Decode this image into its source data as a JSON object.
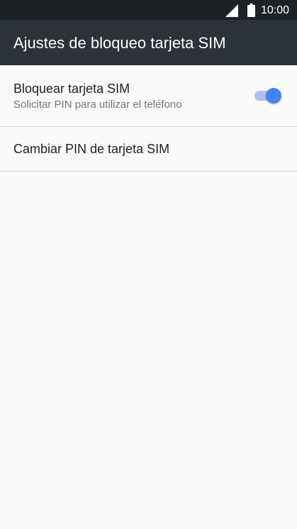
{
  "status_bar": {
    "time": "10:00",
    "signal_icon": "signal-icon",
    "battery_icon": "battery-icon"
  },
  "app_bar": {
    "title": "Ajustes de bloqueo tarjeta SIM"
  },
  "settings": {
    "lock_sim": {
      "title": "Bloquear tarjeta SIM",
      "summary": "Solicitar PIN para utilizar el teléfono",
      "enabled": true,
      "accent_color": "#4285f4"
    },
    "change_pin": {
      "title": "Cambiar PIN de tarjeta SIM"
    }
  }
}
